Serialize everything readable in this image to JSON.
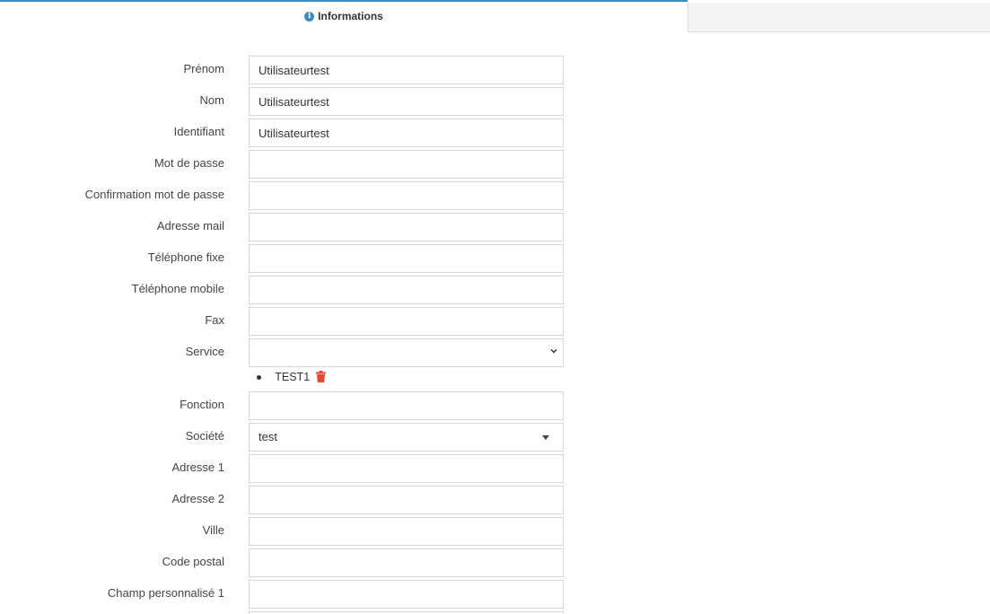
{
  "tabs": [
    {
      "label": "Informations",
      "icon": "info-circle-icon",
      "active": true
    },
    {
      "label": "",
      "active": false
    }
  ],
  "form": {
    "prenom": {
      "label": "Prénom",
      "value": "Utilisateurtest"
    },
    "nom": {
      "label": "Nom",
      "value": "Utilisateurtest"
    },
    "identifiant": {
      "label": "Identifiant",
      "value": "Utilisateurtest"
    },
    "mot_de_passe": {
      "label": "Mot de passe",
      "value": ""
    },
    "confirmation": {
      "label": "Confirmation mot de passe",
      "value": ""
    },
    "adresse_mail": {
      "label": "Adresse mail",
      "value": ""
    },
    "telephone_fixe": {
      "label": "Téléphone fixe",
      "value": ""
    },
    "telephone_mobile": {
      "label": "Téléphone mobile",
      "value": ""
    },
    "fax": {
      "label": "Fax",
      "value": ""
    },
    "service": {
      "label": "Service",
      "value": "",
      "selected_items": [
        "TEST1"
      ]
    },
    "fonction": {
      "label": "Fonction",
      "value": ""
    },
    "societe": {
      "label": "Société",
      "value": "test"
    },
    "adresse1": {
      "label": "Adresse 1",
      "value": ""
    },
    "adresse2": {
      "label": "Adresse 2",
      "value": ""
    },
    "ville": {
      "label": "Ville",
      "value": ""
    },
    "code_postal": {
      "label": "Code postal",
      "value": ""
    },
    "champ1": {
      "label": "Champ personnalisé 1",
      "value": ""
    }
  },
  "colors": {
    "accent": "#3c8dbc",
    "danger": "#dd4b39",
    "border": "#d2d6de"
  }
}
